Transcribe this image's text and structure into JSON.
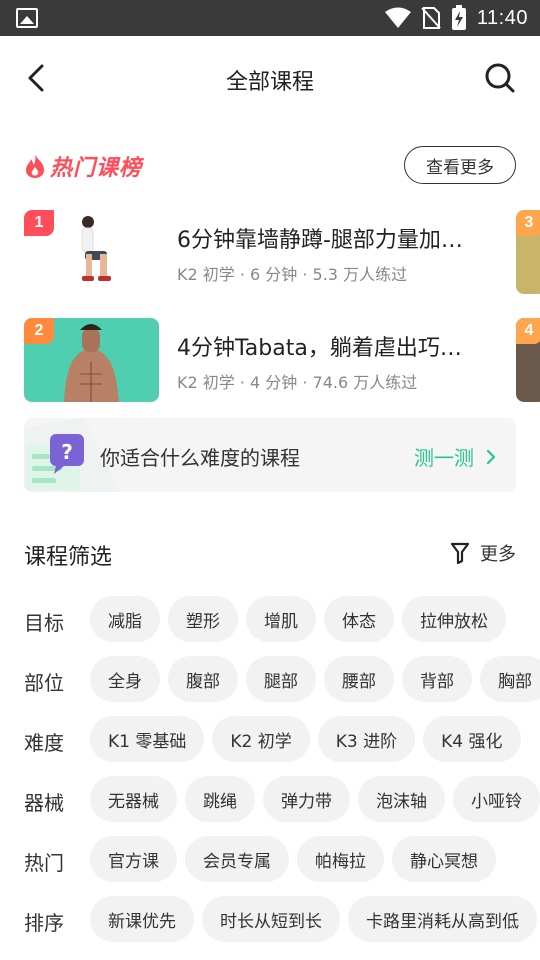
{
  "status_bar": {
    "time": "11:40"
  },
  "nav": {
    "title": "全部课程"
  },
  "hot": {
    "title": "热门课榜",
    "more_label": "查看更多",
    "courses": [
      {
        "rank": "1",
        "title": "6分钟靠墙静蹲-腿部力量加…",
        "meta": "K2 初学 · 6 分钟 · 5.3 万人练过",
        "rank_color": "#ff4d5a"
      },
      {
        "rank": "2",
        "title": "4分钟Tabata，躺着虐出巧…",
        "meta": "K2 初学 · 4 分钟 · 74.6 万人练过",
        "rank_color": "#ff8a3d"
      }
    ],
    "peek": [
      {
        "rank": "3",
        "rank_color": "#ffa64d"
      },
      {
        "rank": "4",
        "rank_color": "#ffa64d"
      }
    ]
  },
  "quiz": {
    "text": "你适合什么难度的课程",
    "action": "测一测"
  },
  "filter": {
    "title": "课程筛选",
    "more_label": "更多",
    "rows": [
      {
        "label": "目标",
        "chips": [
          "减脂",
          "塑形",
          "增肌",
          "体态",
          "拉伸放松"
        ]
      },
      {
        "label": "部位",
        "chips": [
          "全身",
          "腹部",
          "腿部",
          "腰部",
          "背部",
          "胸部"
        ]
      },
      {
        "label": "难度",
        "chips": [
          "K1 零基础",
          "K2 初学",
          "K3 进阶",
          "K4 强化"
        ]
      },
      {
        "label": "器械",
        "chips": [
          "无器械",
          "跳绳",
          "弹力带",
          "泡沫轴",
          "小哑铃"
        ]
      },
      {
        "label": "热门",
        "chips": [
          "官方课",
          "会员专属",
          "帕梅拉",
          "静心冥想"
        ]
      },
      {
        "label": "排序",
        "chips": [
          "新课优先",
          "时长从短到长",
          "卡路里消耗从高到低"
        ]
      }
    ]
  },
  "colors": {
    "accent_green": "#24c789",
    "hot_red": "#ff4d5a"
  }
}
